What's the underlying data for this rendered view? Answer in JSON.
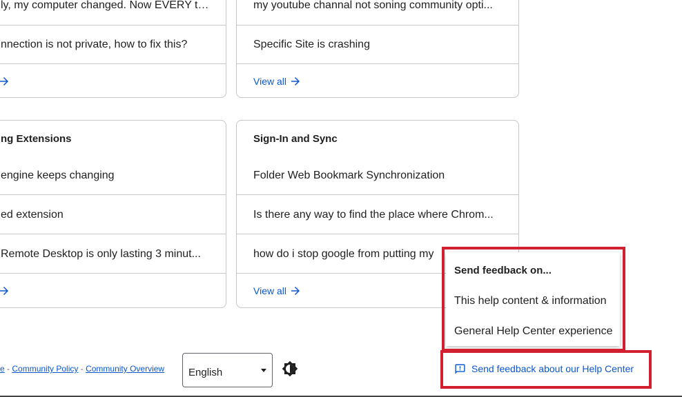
{
  "cards": [
    {
      "id": "top-left",
      "items": [
        "ly, my computer changed. Now EVERY ti...",
        "nnection is not private, how to fix this?"
      ],
      "view_all": ""
    },
    {
      "id": "top-right",
      "items": [
        "my youtube channal not soning community opti...",
        "Specific Site is crashing"
      ],
      "view_all": "View all"
    },
    {
      "id": "bottom-left",
      "title": "ng Extensions",
      "items": [
        "engine keeps changing",
        "ed extension",
        " Remote Desktop is only lasting 3 minut..."
      ],
      "view_all": ""
    },
    {
      "id": "bottom-right",
      "title": "Sign-In and Sync",
      "items": [
        "Folder Web Bookmark Synchronization",
        "Is there any way to find the place where Chrom...",
        "how do i stop google from putting my"
      ],
      "view_all": "View all"
    }
  ],
  "footer": {
    "link_prefix": "e",
    "sep": " - ",
    "community_policy": "Community Policy",
    "community_overview": "Community Overview"
  },
  "language": {
    "selected": "English"
  },
  "feedback_menu": {
    "heading": "Send feedback on...",
    "option1": "This help content & information",
    "option2": "General Help Center experience"
  },
  "feedback_link": {
    "label": "Send feedback about our Help Center"
  },
  "colors": {
    "link": "#0b57d0",
    "highlight": "#d32030",
    "border": "#c4c7c5"
  },
  "icons": {
    "arrow": "arrow-right-icon",
    "theme": "brightness-icon",
    "feedback": "feedback-icon"
  }
}
